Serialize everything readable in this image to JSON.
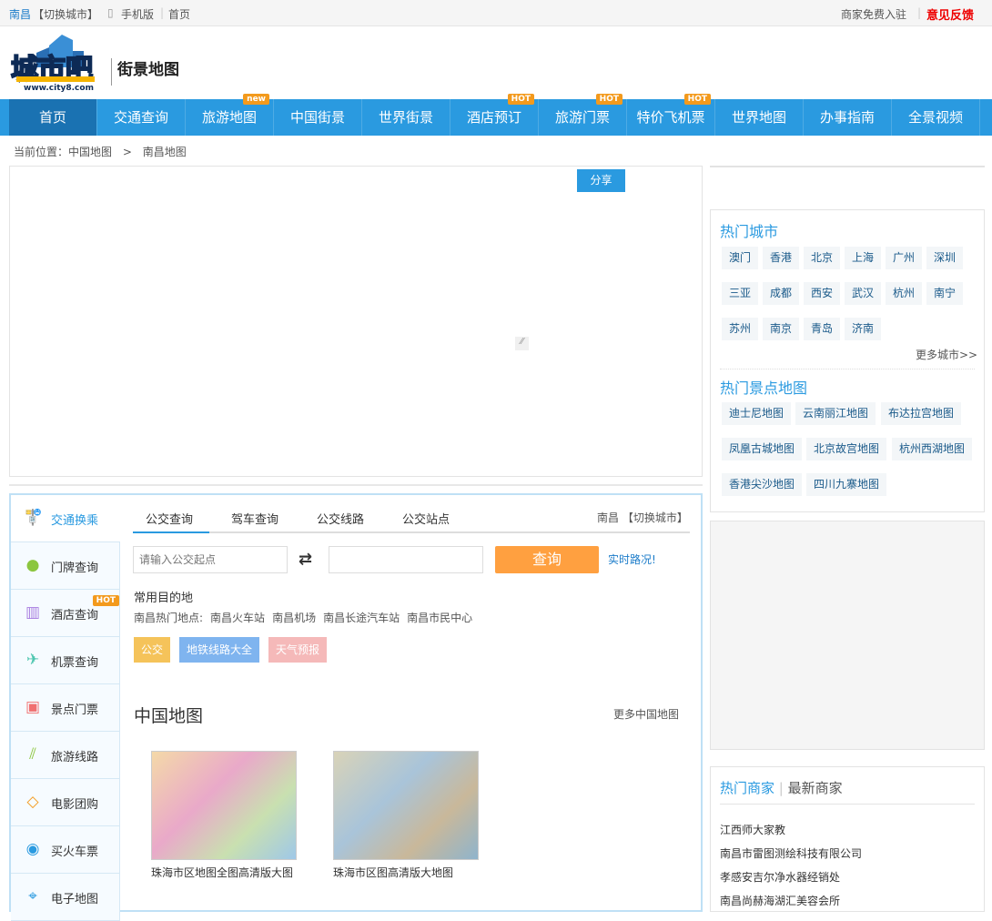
{
  "topbar": {
    "city": "南昌",
    "switch": "【切换城市】",
    "mobile": "手机版",
    "home": "首页",
    "merchant": "商家免费入驻",
    "feedback": "意见反馈"
  },
  "header": {
    "logo_text": "城市吧",
    "logo_url_text": "www.city8.com",
    "subtitle": "街景地图"
  },
  "nav": [
    {
      "label": "首页"
    },
    {
      "label": "交通查询"
    },
    {
      "label": "旅游地图",
      "badge": "new"
    },
    {
      "label": "中国街景"
    },
    {
      "label": "世界街景"
    },
    {
      "label": "酒店预订",
      "badge": "HOT"
    },
    {
      "label": "旅游门票",
      "badge": "HOT"
    },
    {
      "label": "特价飞机票",
      "badge": "HOT"
    },
    {
      "label": "世界地图"
    },
    {
      "label": "办事指南"
    },
    {
      "label": "全景视频"
    }
  ],
  "breadcrumb": {
    "prefix": "当前位置：",
    "items": [
      "中国地图",
      "南昌地图"
    ],
    "sep": ">"
  },
  "map": {
    "share": "分享"
  },
  "hot_cities": {
    "title": "热门城市",
    "items": [
      "澳门",
      "香港",
      "北京",
      "上海",
      "广州",
      "深圳",
      "三亚",
      "成都",
      "西安",
      "武汉",
      "杭州",
      "南宁",
      "苏州",
      "南京",
      "青岛",
      "济南"
    ],
    "more": "更多城市>>"
  },
  "hot_spots": {
    "title": "热门景点地图",
    "items": [
      "迪士尼地图",
      "云南丽江地图",
      "布达拉宫地图",
      "凤凰古城地图",
      "北京故宫地图",
      "杭州西湖地图",
      "香港尖沙地图",
      "四川九寨地图"
    ]
  },
  "merchants": {
    "tab_hot": "热门商家",
    "tab_new": "最新商家",
    "items": [
      "江西师大家教",
      "南昌市雷图测绘科技有限公司",
      "孝感安吉尔净水器经销处",
      "南昌尚赫海湖汇美容会所"
    ]
  },
  "side": [
    {
      "label": "交通换乘",
      "icon": "bus"
    },
    {
      "label": "门牌查询",
      "icon": "pin"
    },
    {
      "label": "酒店查询",
      "icon": "hotel",
      "badge": "HOT"
    },
    {
      "label": "机票查询",
      "icon": "plane"
    },
    {
      "label": "景点门票",
      "icon": "ticket"
    },
    {
      "label": "旅游线路",
      "icon": "route"
    },
    {
      "label": "电影团购",
      "icon": "tag"
    },
    {
      "label": "买火车票",
      "icon": "train"
    },
    {
      "label": "电子地图",
      "icon": "map"
    }
  ],
  "query": {
    "tabs": [
      "公交查询",
      "驾车查询",
      "公交线路",
      "公交站点"
    ],
    "city": "南昌",
    "switch": "【切换城市】",
    "start_placeholder": "请输入公交起点",
    "end_value": "",
    "submit": "查询",
    "realtime": "实时路况!",
    "common_title": "常用目的地",
    "hot_prefix": "南昌热门地点:",
    "hot_places": [
      "南昌火车站",
      "南昌机场",
      "南昌长途汽车站",
      "南昌市民中心"
    ],
    "buttons": [
      {
        "label": "公交",
        "color": "#f5c35a"
      },
      {
        "label": "地铁线路大全",
        "color": "#7fb4ef"
      },
      {
        "label": "天气预报",
        "color": "#f5b9b9"
      }
    ]
  },
  "china_map": {
    "title": "中国地图",
    "more": "更多中国地图",
    "items": [
      {
        "caption": "珠海市区地图全图高清版大图"
      },
      {
        "caption": "珠海市区图高清版大地图"
      }
    ]
  }
}
